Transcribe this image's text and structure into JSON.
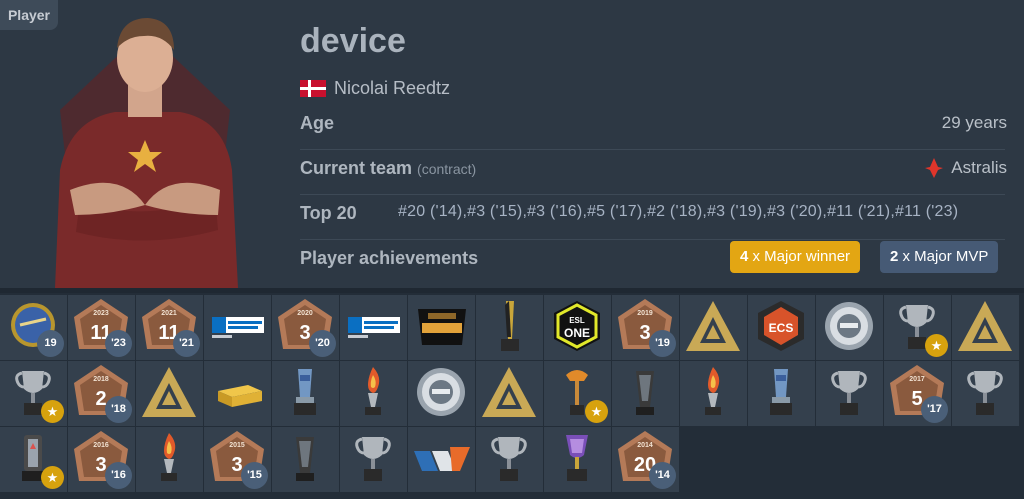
{
  "tag": "Player",
  "player": {
    "nickname": "device",
    "real_name": "Nicolai Reedtz",
    "country": "Denmark",
    "age_label": "Age",
    "age_value": "29 years",
    "team_label": "Current team",
    "team_sub": "(contract)",
    "team_value": "Astralis",
    "top20_label": "Top 20",
    "top20_value": "#20 ('14),#3 ('15),#3 ('16),#5 ('17),#2 ('18),#3 ('19),#3 ('20),#11 ('21),#11 ('23)",
    "achievements_label": "Player achievements",
    "major_winner_count": "4",
    "major_winner_label": "x Major winner",
    "major_mvp_count": "2",
    "major_mvp_label": "x Major MVP"
  },
  "trophies": [
    {
      "icon": "coin-trophy-icon",
      "year": "19",
      "star": false
    },
    {
      "icon": "top20-ranking-icon",
      "rank": "11",
      "rank_year": "2023",
      "year": "'23",
      "star": false
    },
    {
      "icon": "top20-ranking-icon",
      "rank": "11",
      "rank_year": "2021",
      "year": "'21",
      "star": false
    },
    {
      "icon": "intel-extreme-masters-icon",
      "year": "",
      "star": false
    },
    {
      "icon": "top20-ranking-icon",
      "rank": "3",
      "rank_year": "2020",
      "year": "'20",
      "star": false
    },
    {
      "icon": "intel-extreme-masters-icon",
      "year": "",
      "star": false
    },
    {
      "icon": "dreamhack-masters-icon",
      "year": "",
      "star": false
    },
    {
      "icon": "twisted-trophy-icon",
      "year": "",
      "star": false
    },
    {
      "icon": "esl-one-icon",
      "year": "",
      "star": false
    },
    {
      "icon": "top20-ranking-icon",
      "rank": "3",
      "rank_year": "2019",
      "year": "'19",
      "star": false
    },
    {
      "icon": "blast-trophy-icon",
      "year": "",
      "star": false
    },
    {
      "icon": "ecs-logo-icon",
      "year": "",
      "star": false
    },
    {
      "icon": "plate-trophy-icon",
      "year": "",
      "star": false
    },
    {
      "icon": "cup-trophy-icon",
      "year": "",
      "star": true
    },
    {
      "icon": "blast-trophy-icon",
      "year": "",
      "star": false
    },
    {
      "icon": "cup-trophy-icon",
      "year": "",
      "star": true
    },
    {
      "icon": "top20-ranking-icon",
      "rank": "2",
      "rank_year": "2018",
      "year": "'18",
      "star": false
    },
    {
      "icon": "blast-trophy-icon",
      "year": "",
      "star": false
    },
    {
      "icon": "gold-bar-icon",
      "year": "",
      "star": false
    },
    {
      "icon": "glass-trophy-icon",
      "year": "",
      "star": false
    },
    {
      "icon": "flame-trophy-icon",
      "year": "",
      "star": false
    },
    {
      "icon": "plate-trophy-icon",
      "year": "",
      "star": false
    },
    {
      "icon": "blast-trophy-icon",
      "year": "",
      "star": false
    },
    {
      "icon": "torch-trophy-icon",
      "year": "",
      "star": true
    },
    {
      "icon": "tower-trophy-icon",
      "year": "",
      "star": false
    },
    {
      "icon": "flame-trophy-icon",
      "year": "",
      "star": false
    },
    {
      "icon": "glass-trophy-icon",
      "year": "",
      "star": false
    },
    {
      "icon": "cup-trophy-icon",
      "year": "",
      "star": false
    },
    {
      "icon": "top20-ranking-icon",
      "rank": "5",
      "rank_year": "2017",
      "year": "'17",
      "star": false
    },
    {
      "icon": "cup-trophy-icon",
      "year": "",
      "star": false
    },
    {
      "icon": "pillar-trophy-icon",
      "year": "",
      "star": true
    },
    {
      "icon": "top20-ranking-icon",
      "rank": "3",
      "rank_year": "2016",
      "year": "'16",
      "star": false
    },
    {
      "icon": "flame-trophy-icon",
      "year": "",
      "star": false
    },
    {
      "icon": "top20-ranking-icon",
      "rank": "3",
      "rank_year": "2015",
      "year": "'15",
      "star": false
    },
    {
      "icon": "tower-trophy-icon",
      "year": "",
      "star": false
    },
    {
      "icon": "cup-trophy-icon",
      "year": "",
      "star": false
    },
    {
      "icon": "wave-logo-icon",
      "year": "",
      "star": false
    },
    {
      "icon": "cup-trophy-icon",
      "year": "",
      "star": false
    },
    {
      "icon": "purple-trophy-icon",
      "year": "",
      "star": false
    },
    {
      "icon": "top20-ranking-icon",
      "rank": "20",
      "rank_year": "2014",
      "year": "'14",
      "star": false
    }
  ],
  "colors": {
    "gold_badge": "#e3a613",
    "blue_badge": "#465a75",
    "year_bubble": "#4a5f78",
    "star": "#d7a20e"
  }
}
